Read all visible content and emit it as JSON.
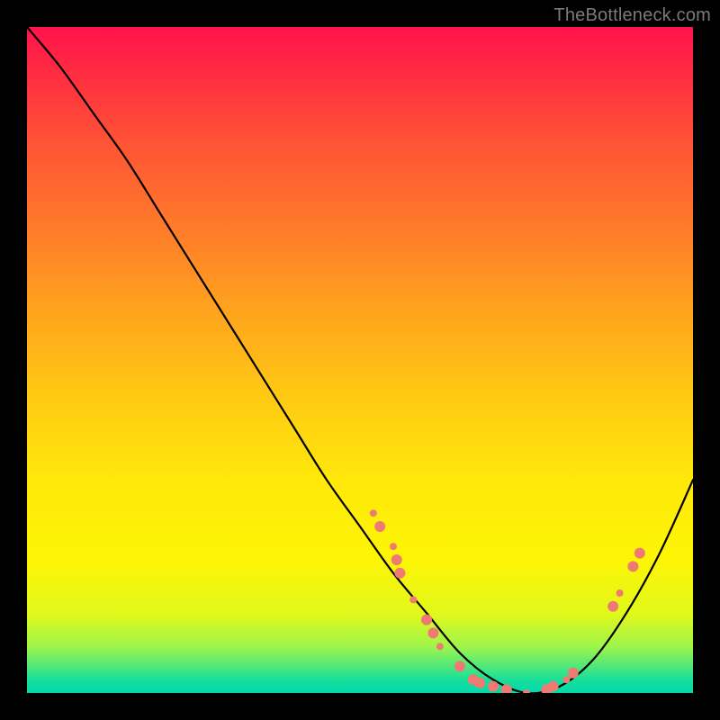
{
  "watermark": "TheBottleneck.com",
  "chart_data": {
    "type": "line",
    "title": "",
    "xlabel": "",
    "ylabel": "",
    "xlim": [
      0,
      100
    ],
    "ylim": [
      0,
      100
    ],
    "grid": false,
    "series": [
      {
        "name": "bottleneck-curve",
        "color": "#000000",
        "x": [
          0,
          5,
          10,
          15,
          20,
          25,
          30,
          35,
          40,
          45,
          50,
          55,
          60,
          65,
          70,
          75,
          80,
          85,
          90,
          95,
          100
        ],
        "values": [
          100,
          94,
          87,
          80,
          72,
          64,
          56,
          48,
          40,
          32,
          25,
          18,
          12,
          6,
          2,
          0,
          1,
          5,
          12,
          21,
          32
        ]
      }
    ],
    "markers": {
      "name": "sample-points",
      "color": "#ef7a72",
      "radius_small": 4,
      "radius_large": 6,
      "points": [
        {
          "x": 52,
          "y": 27,
          "r": 4
        },
        {
          "x": 53,
          "y": 25,
          "r": 6
        },
        {
          "x": 55,
          "y": 22,
          "r": 4
        },
        {
          "x": 55.5,
          "y": 20,
          "r": 6
        },
        {
          "x": 56,
          "y": 18,
          "r": 6
        },
        {
          "x": 58,
          "y": 14,
          "r": 4
        },
        {
          "x": 60,
          "y": 11,
          "r": 6
        },
        {
          "x": 61,
          "y": 9,
          "r": 6
        },
        {
          "x": 62,
          "y": 7,
          "r": 4
        },
        {
          "x": 65,
          "y": 4,
          "r": 6
        },
        {
          "x": 67,
          "y": 2,
          "r": 6
        },
        {
          "x": 68,
          "y": 1.5,
          "r": 6
        },
        {
          "x": 70,
          "y": 1,
          "r": 6
        },
        {
          "x": 72,
          "y": 0.5,
          "r": 6
        },
        {
          "x": 75,
          "y": 0,
          "r": 4
        },
        {
          "x": 78,
          "y": 0.5,
          "r": 6
        },
        {
          "x": 79,
          "y": 1,
          "r": 6
        },
        {
          "x": 81,
          "y": 2,
          "r": 4
        },
        {
          "x": 82,
          "y": 3,
          "r": 6
        },
        {
          "x": 88,
          "y": 13,
          "r": 6
        },
        {
          "x": 89,
          "y": 15,
          "r": 4
        },
        {
          "x": 91,
          "y": 19,
          "r": 6
        },
        {
          "x": 92,
          "y": 21,
          "r": 6
        }
      ]
    }
  }
}
